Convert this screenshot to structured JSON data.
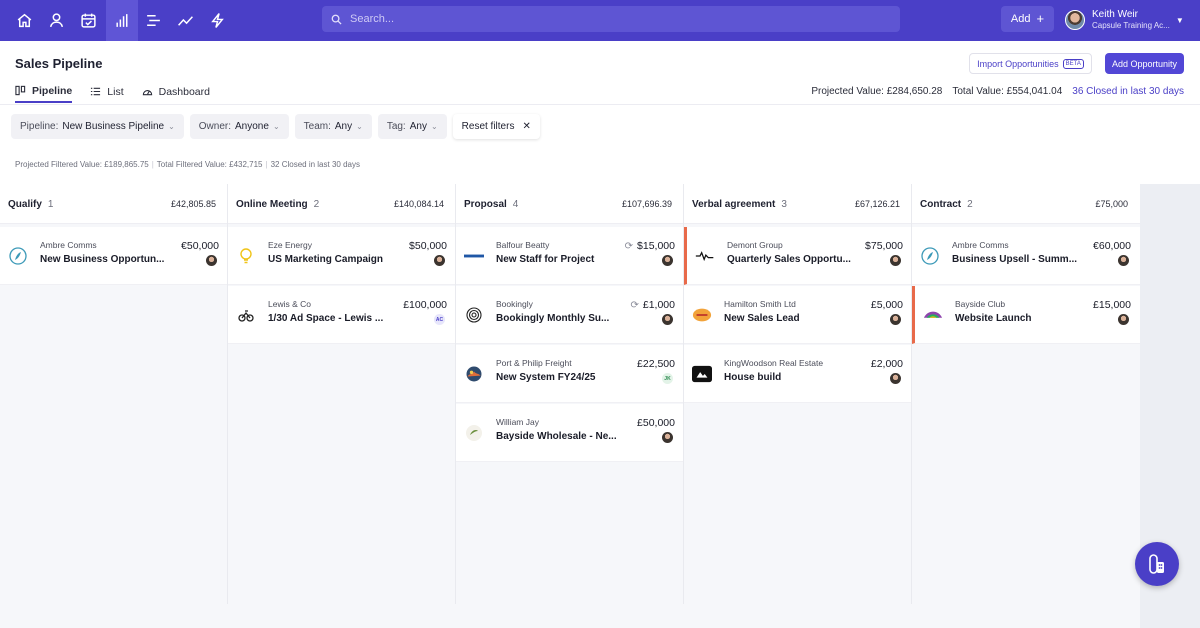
{
  "topbar": {
    "nav_icons": [
      "home-icon",
      "contacts-icon",
      "calendar-icon",
      "pipeline-icon",
      "cases-icon",
      "analytics-icon",
      "workflow-icon"
    ],
    "search_placeholder": "Search...",
    "add_label": "Add",
    "user_name": "Keith Weir",
    "user_org": "Capsule Training Ac...",
    "accent": "#4a3fc7"
  },
  "header": {
    "title": "Sales Pipeline",
    "import_label": "Import Opportunities",
    "beta_badge": "BETA",
    "add_opportunity_label": "Add Opportunity"
  },
  "tabs": [
    {
      "label": "Pipeline",
      "icon": "pipeline-board-icon",
      "active": true
    },
    {
      "label": "List",
      "icon": "list-icon",
      "active": false
    },
    {
      "label": "Dashboard",
      "icon": "dashboard-icon",
      "active": false
    }
  ],
  "totals": {
    "projected": "Projected Value: £284,650.28",
    "total": "Total Value: £554,041.04",
    "closed": "36 Closed in last 30 days"
  },
  "filters": {
    "pipeline_label": "Pipeline:",
    "pipeline_value": "New Business Pipeline",
    "owner_label": "Owner:",
    "owner_value": "Anyone",
    "team_label": "Team:",
    "team_value": "Any",
    "tag_label": "Tag:",
    "tag_value": "Any",
    "reset_label": "Reset filters"
  },
  "filtered_summary": {
    "projected": "Projected Filtered Value: £189,865.75",
    "total": "Total Filtered Value: £432,715",
    "closed": "32 Closed in last 30 days"
  },
  "columns": [
    {
      "name": "Qualify",
      "count": "1",
      "total": "£42,805.85",
      "cards": [
        {
          "org": "Ambre Comms",
          "title": "New Business Opportun...",
          "amount": "€50,000",
          "logo": "ambre-logo-icon"
        }
      ]
    },
    {
      "name": "Online Meeting",
      "count": "2",
      "total": "£140,084.14",
      "cards": [
        {
          "org": "Eze Energy",
          "title": "US Marketing Campaign",
          "amount": "$50,000",
          "logo": "lightbulb-logo-icon"
        },
        {
          "org": "Lewis & Co",
          "title": "1/30 Ad Space - Lewis ...",
          "amount": "£100,000",
          "logo": "cyclist-logo-icon",
          "owner_initials": "AC"
        }
      ]
    },
    {
      "name": "Proposal",
      "count": "4",
      "total": "£107,696.39",
      "cards": [
        {
          "org": "Balfour Beatty",
          "title": "New Staff for Project",
          "amount": "$15,000",
          "logo": "balfour-logo-icon",
          "recurring": true
        },
        {
          "org": "Bookingly",
          "title": "Bookingly Monthly Su...",
          "amount": "£1,000",
          "logo": "fingerprint-logo-icon",
          "recurring": true
        },
        {
          "org": "Port & Philip Freight",
          "title": "New System FY24/25",
          "amount": "£22,500",
          "logo": "freight-logo-icon",
          "owner_initials": "JK"
        },
        {
          "org": "William Jay",
          "title": "Bayside Wholesale - Ne...",
          "amount": "£50,000",
          "logo": "william-jay-logo-icon"
        }
      ]
    },
    {
      "name": "Verbal agreement",
      "count": "3",
      "total": "£67,126.21",
      "cards": [
        {
          "org": "Demont Group",
          "title": "Quarterly Sales Opportu...",
          "amount": "$75,000",
          "logo": "demont-logo-icon",
          "flag": true
        },
        {
          "org": "Hamilton Smith Ltd",
          "title": "New Sales Lead",
          "amount": "£5,000",
          "logo": "hamilton-logo-icon"
        },
        {
          "org": "KingWoodson Real Estate",
          "title": "House build",
          "amount": "£2,000",
          "logo": "kingwoodson-logo-icon"
        }
      ]
    },
    {
      "name": "Contract",
      "count": "2",
      "total": "£75,000",
      "cards": [
        {
          "org": "Ambre Comms",
          "title": "Business Upsell - Summ...",
          "amount": "€60,000",
          "logo": "ambre-logo-icon"
        },
        {
          "org": "Bayside Club",
          "title": "Website Launch",
          "amount": "£15,000",
          "logo": "bayside-logo-icon",
          "flag": true
        }
      ]
    }
  ],
  "fab_icon": "help-widget-icon"
}
